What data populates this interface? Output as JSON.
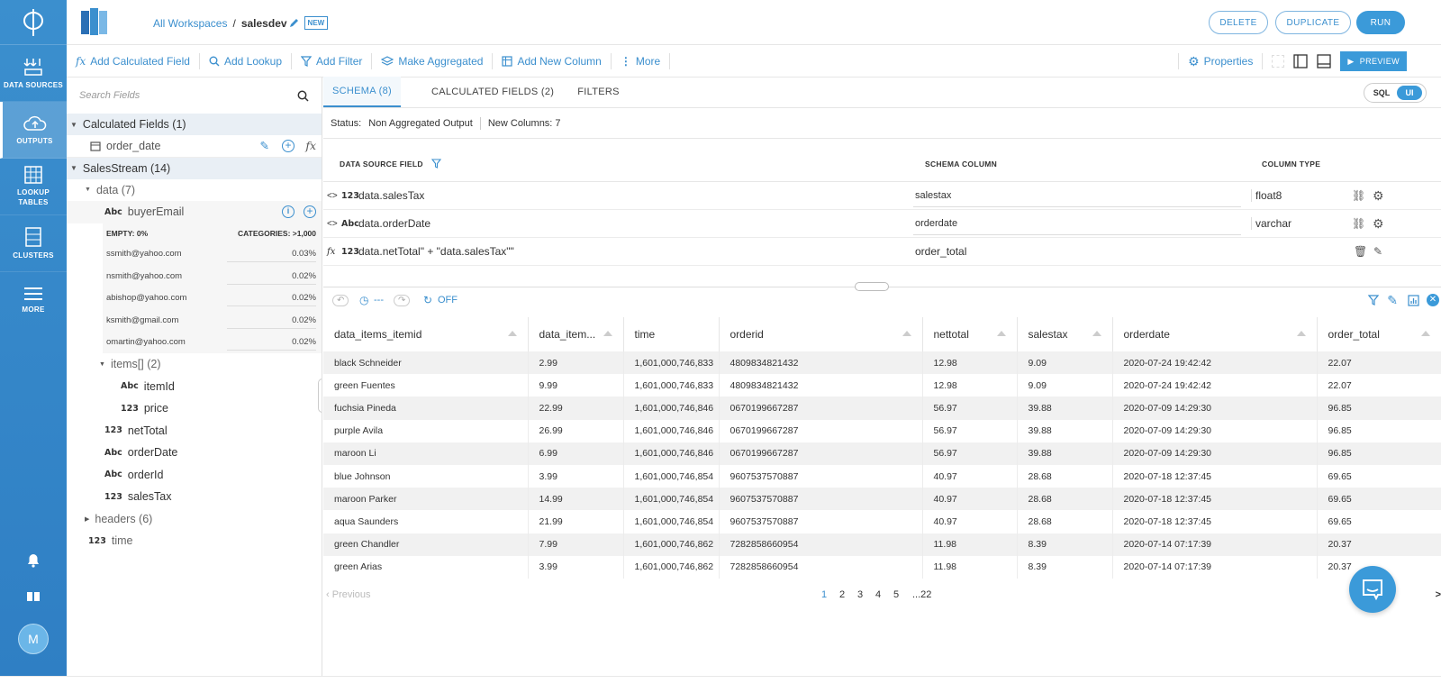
{
  "nav": {
    "items": [
      {
        "label": "DATA SOURCES",
        "icon": "data-sources-icon"
      },
      {
        "label": "OUTPUTS",
        "icon": "cloud-upload-icon"
      },
      {
        "label": "LOOKUP TABLES",
        "icon": "grid-icon"
      },
      {
        "label": "CLUSTERS",
        "icon": "clusters-icon"
      },
      {
        "label": "MORE",
        "icon": "hamburger-icon"
      }
    ],
    "avatar": "M"
  },
  "header": {
    "workspaces": "All Workspaces",
    "separator": "/",
    "name": "salesdev",
    "badge": "NEW",
    "buttons": {
      "delete": "DELETE",
      "duplicate": "DUPLICATE",
      "run": "RUN"
    }
  },
  "toolbar": {
    "items": [
      "Add Calculated Field",
      "Add Lookup",
      "Add Filter",
      "Make Aggregated",
      "Add New Column",
      "More"
    ],
    "properties": "Properties",
    "preview": "PREVIEW"
  },
  "fields": {
    "search_placeholder": "Search Fields",
    "calculated_group": "Calculated Fields (1)",
    "calculated_field": "order_date",
    "stream_group": "SalesStream (14)",
    "data_group": "data (7)",
    "buyer_type": "Abc",
    "buyer_email": "buyerEmail",
    "stats": {
      "empty": "EMPTY: 0%",
      "categories": "CATEGORIES: >1,000",
      "rows": [
        {
          "email": "ssmith@yahoo.com",
          "pct": "0.03%"
        },
        {
          "email": "nsmith@yahoo.com",
          "pct": "0.02%"
        },
        {
          "email": "abishop@yahoo.com",
          "pct": "0.02%"
        },
        {
          "email": "ksmith@gmail.com",
          "pct": "0.02%"
        },
        {
          "email": "omartin@yahoo.com",
          "pct": "0.02%"
        }
      ]
    },
    "items_group": "items[] (2)",
    "items_children": [
      {
        "type": "Abc",
        "name": "itemId"
      },
      {
        "type": "123",
        "name": "price"
      }
    ],
    "data_children": [
      {
        "type": "123",
        "name": "netTotal"
      },
      {
        "type": "Abc",
        "name": "orderDate"
      },
      {
        "type": "Abc",
        "name": "orderId"
      },
      {
        "type": "123",
        "name": "salesTax"
      }
    ],
    "headers_group": "headers (6)",
    "time_field": {
      "type": "123",
      "name": "time"
    }
  },
  "main": {
    "tabs": [
      "SCHEMA (8)",
      "CALCULATED FIELDS (2)",
      "FILTERS"
    ],
    "toggle": {
      "sql": "SQL",
      "ui": "UI"
    },
    "status_label": "Status:",
    "status_value": "Non Aggregated Output",
    "new_columns": "New Columns: 7",
    "schema_headers": {
      "source": "DATA SOURCE FIELD",
      "column": "SCHEMA COLUMN",
      "type": "COLUMN TYPE"
    },
    "schema_rows": [
      {
        "prefix": "<>",
        "type": "123",
        "field": "data.salesTax",
        "column": "salestax",
        "coltype": "float8"
      },
      {
        "prefix": "<>",
        "type": "Abc",
        "field": "data.orderDate",
        "column": "orderdate",
        "coltype": "varchar"
      },
      {
        "prefix": "fx",
        "type": "123",
        "field": "data.netTotal\" + \"data.salesTax\"\"",
        "column": "order_total",
        "coltype": ""
      }
    ],
    "data_toolbar": {
      "time": "---",
      "refresh": "OFF"
    },
    "columns": [
      "data_items_itemid",
      "data_item...",
      "time",
      "orderid",
      "nettotal",
      "salestax",
      "orderdate",
      "order_total"
    ],
    "rows": [
      [
        "black Schneider",
        "2.99",
        "1,601,000,746,833",
        "4809834821432",
        "12.98",
        "9.09",
        "2020-07-24 19:42:42",
        "22.07"
      ],
      [
        "green Fuentes",
        "9.99",
        "1,601,000,746,833",
        "4809834821432",
        "12.98",
        "9.09",
        "2020-07-24 19:42:42",
        "22.07"
      ],
      [
        "fuchsia Pineda",
        "22.99",
        "1,601,000,746,846",
        "0670199667287",
        "56.97",
        "39.88",
        "2020-07-09 14:29:30",
        "96.85"
      ],
      [
        "purple Avila",
        "26.99",
        "1,601,000,746,846",
        "0670199667287",
        "56.97",
        "39.88",
        "2020-07-09 14:29:30",
        "96.85"
      ],
      [
        "maroon Li",
        "6.99",
        "1,601,000,746,846",
        "0670199667287",
        "56.97",
        "39.88",
        "2020-07-09 14:29:30",
        "96.85"
      ],
      [
        "blue Johnson",
        "3.99",
        "1,601,000,746,854",
        "9607537570887",
        "40.97",
        "28.68",
        "2020-07-18 12:37:45",
        "69.65"
      ],
      [
        "maroon Parker",
        "14.99",
        "1,601,000,746,854",
        "9607537570887",
        "40.97",
        "28.68",
        "2020-07-18 12:37:45",
        "69.65"
      ],
      [
        "aqua Saunders",
        "21.99",
        "1,601,000,746,854",
        "9607537570887",
        "40.97",
        "28.68",
        "2020-07-18 12:37:45",
        "69.65"
      ],
      [
        "green Chandler",
        "7.99",
        "1,601,000,746,862",
        "7282858660954",
        "11.98",
        "8.39",
        "2020-07-14 07:17:39",
        "20.37"
      ],
      [
        "green Arias",
        "3.99",
        "1,601,000,746,862",
        "7282858660954",
        "11.98",
        "8.39",
        "2020-07-14 07:17:39",
        "20.37"
      ]
    ],
    "pager": {
      "previous": "Previous",
      "pages": [
        "1",
        "2",
        "3",
        "4",
        "5",
        "...22"
      ],
      "next": ">"
    }
  },
  "colors": {
    "accent": "#3b8fce",
    "nav": "#3b8fce",
    "run": "#3b9ad9"
  }
}
